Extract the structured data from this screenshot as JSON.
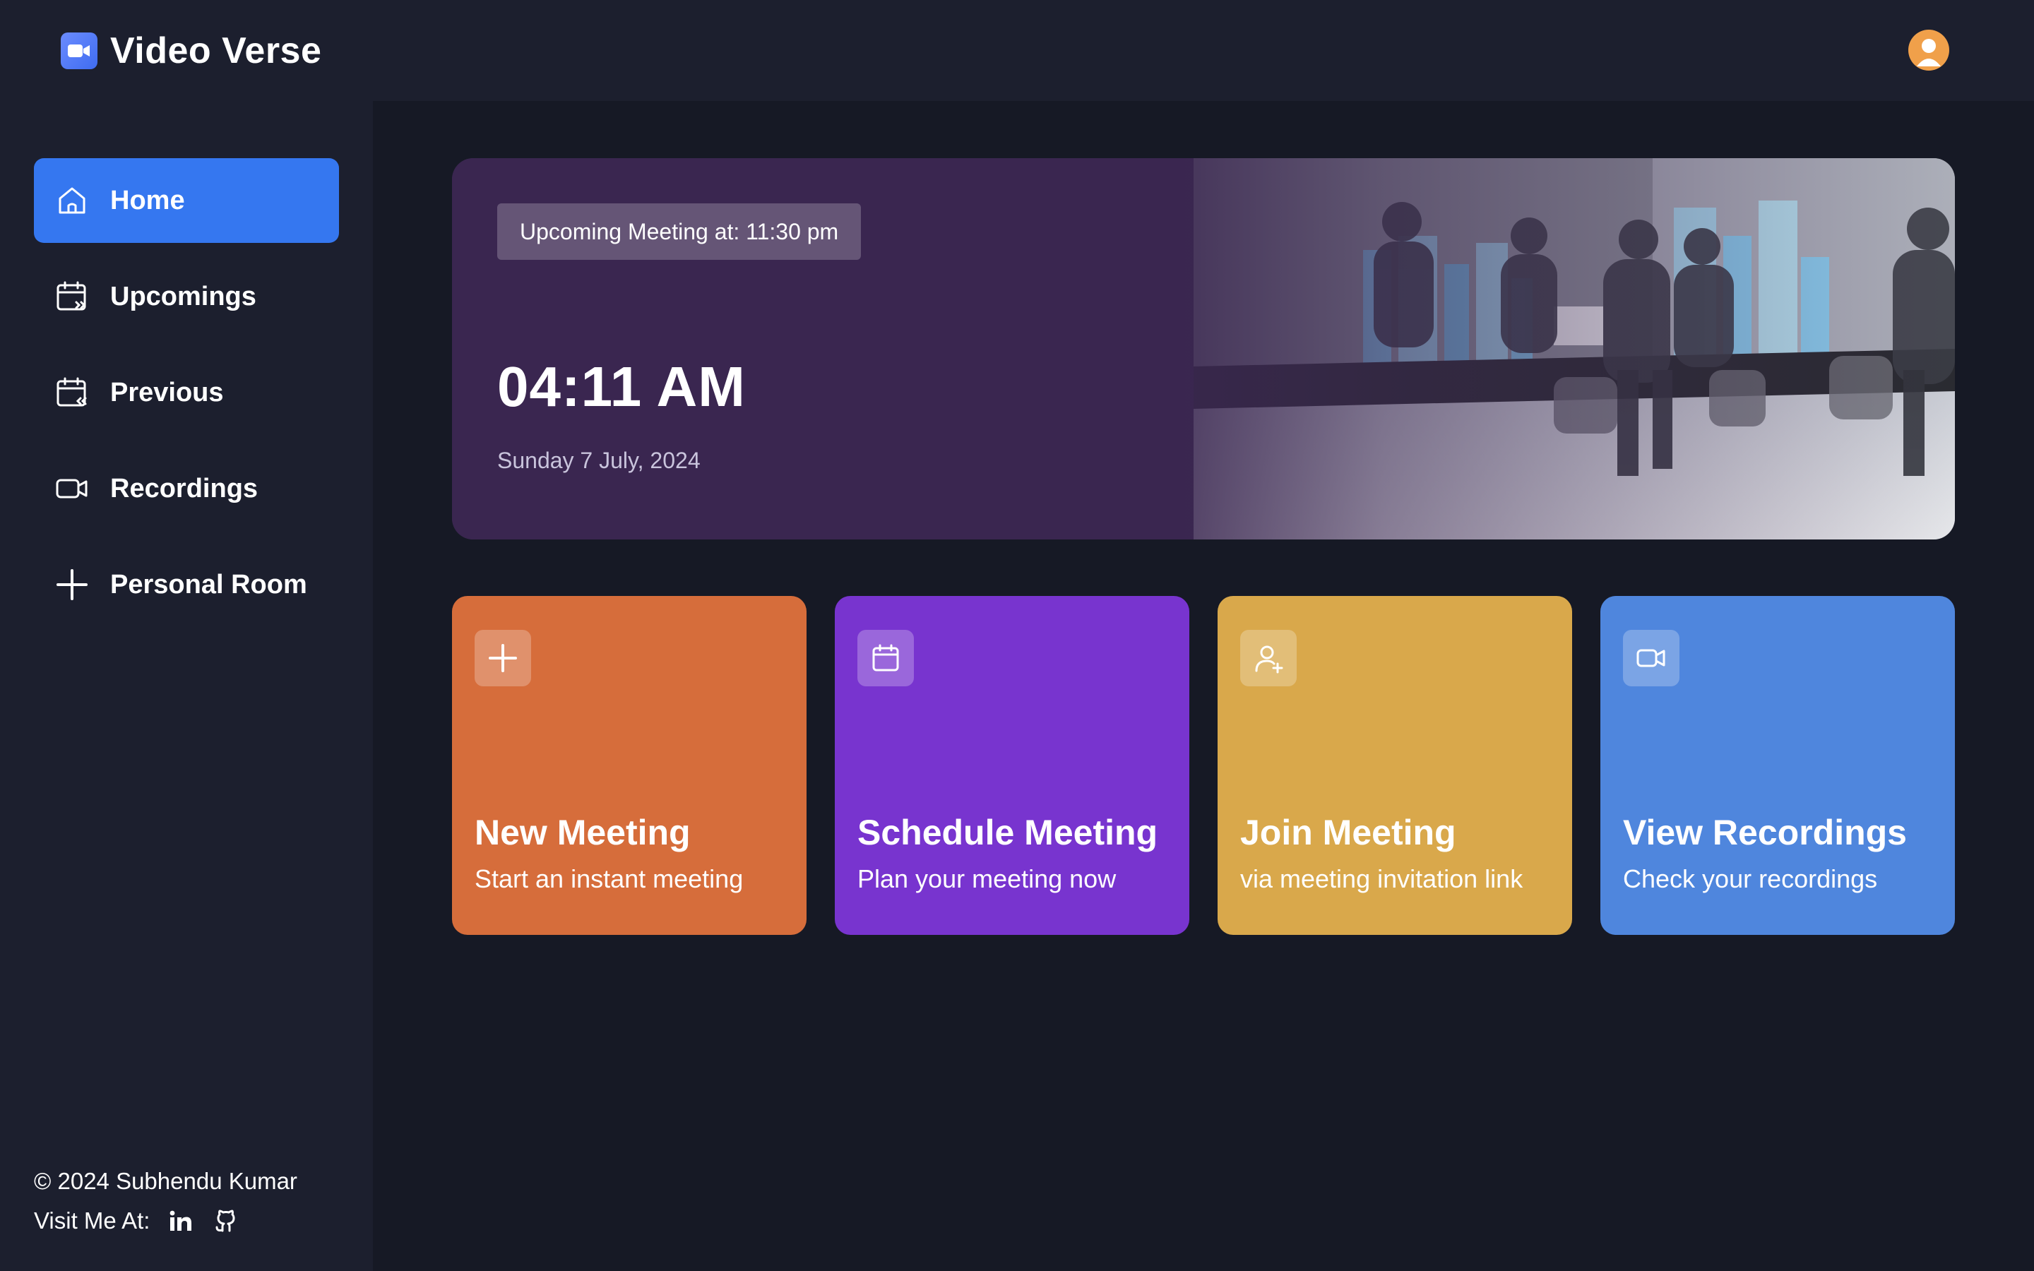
{
  "app": {
    "name": "Video Verse"
  },
  "sidebar": {
    "items": [
      {
        "label": "Home",
        "icon": "home-icon",
        "active": true
      },
      {
        "label": "Upcomings",
        "icon": "calendar-forward-icon",
        "active": false
      },
      {
        "label": "Previous",
        "icon": "calendar-back-icon",
        "active": false
      },
      {
        "label": "Recordings",
        "icon": "video-icon",
        "active": false
      },
      {
        "label": "Personal Room",
        "icon": "plus-icon",
        "active": false
      }
    ],
    "footer": {
      "copyright": "© 2024  Subhendu Kumar",
      "visit_label": "Visit Me At:"
    }
  },
  "hero": {
    "upcoming": "Upcoming Meeting at: 11:30 pm",
    "time": "04:11 AM",
    "date": "Sunday 7 July, 2024"
  },
  "cards": [
    {
      "title": "New Meeting",
      "subtitle": "Start an instant meeting",
      "color": "#d66d3b",
      "icon": "plus-icon"
    },
    {
      "title": "Schedule Meeting",
      "subtitle": "Plan your meeting now",
      "color": "#7834cf",
      "icon": "calendar-icon"
    },
    {
      "title": "Join Meeting",
      "subtitle": "via meeting invitation link",
      "color": "#d9a84b",
      "icon": "user-plus-icon"
    },
    {
      "title": "View Recordings",
      "subtitle": "Check your recordings",
      "color": "#4f86dd",
      "icon": "video-icon"
    }
  ],
  "colors": {
    "accent": "#3577f0",
    "background": "#1c1f2e",
    "main_background": "#161925"
  }
}
